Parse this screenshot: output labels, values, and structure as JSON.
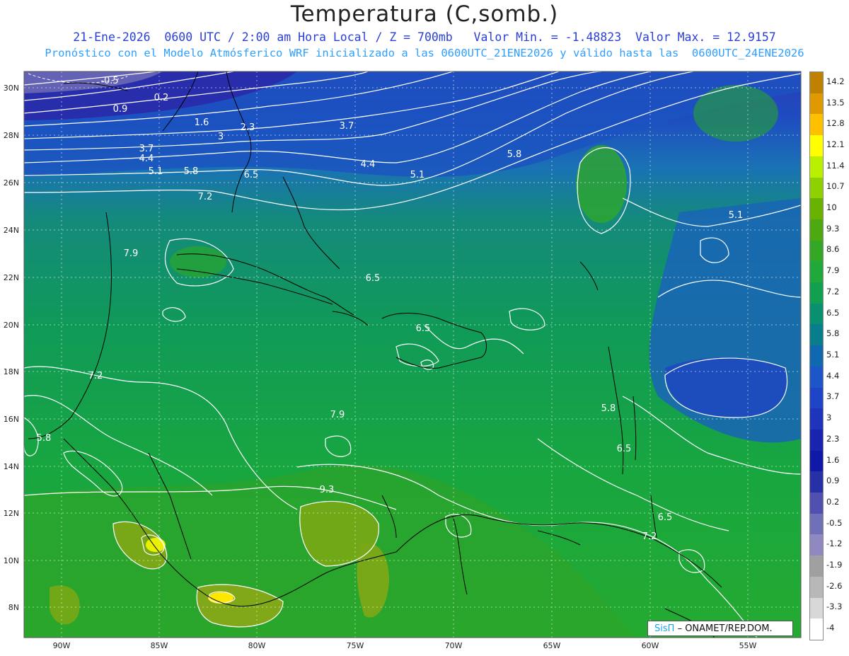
{
  "header": {
    "title": "Temperatura (C,somb.)",
    "line1": "21-Ene-2026  0600 UTC / 2:00 am Hora Local / Z = 700mb   Valor Min. = -1.48823  Valor Max. = 12.9157",
    "line2": "Pronóstico con el Modelo Atmósferico WRF inicializado a las 0600UTC_21ENE2026 y válido hasta las  0600UTC_24ENE2026"
  },
  "map": {
    "lat_labels": [
      "30N",
      "28N",
      "26N",
      "24N",
      "22N",
      "20N",
      "18N",
      "16N",
      "14N",
      "12N",
      "10N",
      "8N"
    ],
    "lon_labels": [
      "90W",
      "85W",
      "80W",
      "75W",
      "70W",
      "65W",
      "60W",
      "55W"
    ],
    "contour_labels": [
      {
        "text": "-0.5"
      },
      {
        "text": "0.2"
      },
      {
        "text": "0.9"
      },
      {
        "text": "1.6"
      },
      {
        "text": "2.3"
      },
      {
        "text": "3"
      },
      {
        "text": "3.7"
      },
      {
        "text": "3.7"
      },
      {
        "text": "4.4"
      },
      {
        "text": "4.4"
      },
      {
        "text": "5.1"
      },
      {
        "text": "5.8"
      },
      {
        "text": "6.5"
      },
      {
        "text": "7.2"
      },
      {
        "text": "5.1"
      },
      {
        "text": "5.8"
      },
      {
        "text": "5.1"
      },
      {
        "text": "7.9"
      },
      {
        "text": "6.5"
      },
      {
        "text": "6.5"
      },
      {
        "text": "7.2"
      },
      {
        "text": "7.9"
      },
      {
        "text": "5.8"
      },
      {
        "text": "5.8"
      },
      {
        "text": "6.5"
      },
      {
        "text": "9.3"
      },
      {
        "text": "6.5"
      },
      {
        "text": "7.2"
      }
    ]
  },
  "colorbar": {
    "labels": [
      "14.2",
      "13.5",
      "12.8",
      "12.1",
      "11.4",
      "10.7",
      "10",
      "9.3",
      "8.6",
      "7.9",
      "7.2",
      "6.5",
      "5.8",
      "5.1",
      "4.4",
      "3.7",
      "3",
      "2.3",
      "1.6",
      "0.9",
      "0.2",
      "-0.5",
      "-1.2",
      "-1.9",
      "-2.6",
      "-3.3",
      "-4"
    ],
    "colors": [
      "#c08000",
      "#e09a00",
      "#ffc000",
      "#ffff00",
      "#b8f000",
      "#8ed000",
      "#6ab200",
      "#4ea810",
      "#34a824",
      "#20a83a",
      "#10a050",
      "#089070",
      "#087e8c",
      "#1068b0",
      "#1c56c8",
      "#1e44c8",
      "#1e34bc",
      "#1a22b0",
      "#1018a8",
      "#2830a8",
      "#5050b0",
      "#7070b8",
      "#9088c0",
      "#a0a0a0",
      "#b8b8b8",
      "#d8d8d8",
      "#ffffff"
    ]
  },
  "logo": {
    "brand": "SisΠ",
    "rest": "– ONAMET/REP.DOM."
  }
}
